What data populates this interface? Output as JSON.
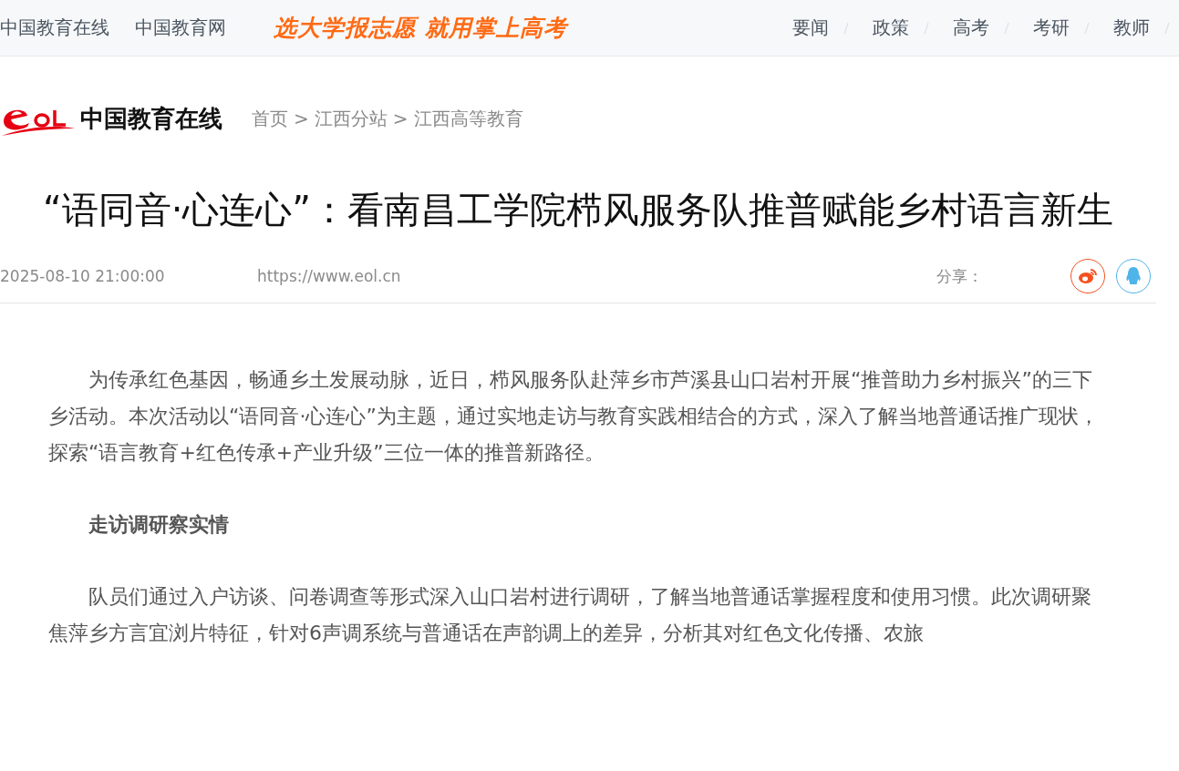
{
  "top_bar": {
    "links": [
      "中国教育在线",
      "中国教育网"
    ],
    "slogan": "选大学报志愿 就用掌上高考",
    "nav": [
      "要闻",
      "政策",
      "高考",
      "考研",
      "教师"
    ]
  },
  "header": {
    "logo_text": "中国教育在线",
    "breadcrumb": [
      "首页",
      "江西分站",
      "江西高等教育"
    ],
    "separator": ">"
  },
  "article": {
    "title": "“语同音·心连心”：看南昌工学院栉风服务队推普赋能乡村语言新生",
    "date": "2025-08-10 21:00:00",
    "source": "https://www.eol.cn",
    "share_label": "分享：",
    "blocks": [
      {
        "kind": "paragraph",
        "text": "为传承红色基因，畅通乡土发展动脉，近日，栉风服务队赴萍乡市芦溪县山口岩村开展“推普助力乡村振兴”的三下乡活动。本次活动以“语同音·心连心”为主题，通过实地走访与教育实践相结合的方式，深入了解当地普通话推广现状，探索“语言教育+红色传承+产业升级”三位一体的推普新路径。"
      },
      {
        "kind": "heading",
        "text": "走访调研察实情"
      },
      {
        "kind": "paragraph",
        "text": "队员们通过入户访谈、问卷调查等形式深入山口岩村进行调研，了解当地普通话掌握程度和使用习惯。此次调研聚焦萍乡方言宜浏片特征，针对6声调系统与普通话在声韵调上的差异，分析其对红色文化传播、农旅"
      }
    ]
  }
}
